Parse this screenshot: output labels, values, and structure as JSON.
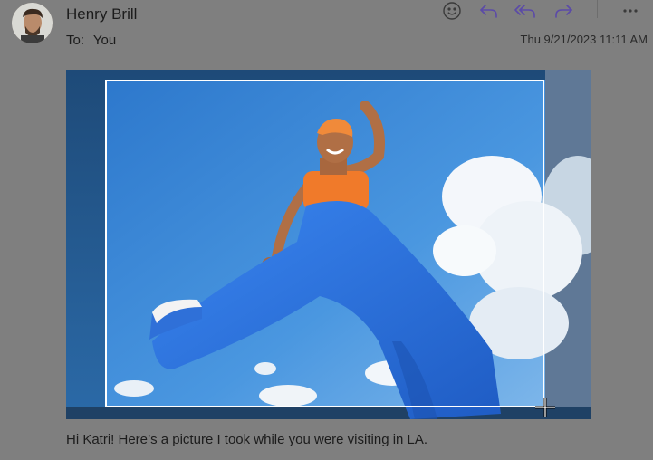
{
  "message": {
    "sender_name": "Henry Brill",
    "to_label": "To:",
    "recipient": "You",
    "timestamp": "Thu 9/21/2023 11:11 AM",
    "body": "Hi Katri! Here’s a picture I took while you were visiting in LA."
  },
  "toolbar": {
    "buttons": [
      {
        "icon": "emoji-icon",
        "action": "react"
      },
      {
        "icon": "reply-icon",
        "action": "reply"
      },
      {
        "icon": "reply-all-icon",
        "action": "reply-all"
      },
      {
        "icon": "forward-icon",
        "action": "forward"
      },
      {
        "icon": "more-icon",
        "action": "more"
      }
    ]
  },
  "attachment": {
    "type": "image",
    "subject": "person in blue pants and orange top posing against sky",
    "selection": "crop"
  },
  "colors": {
    "overlay": "#7f7f7f",
    "accent": "#5b4aa8",
    "sky": "#3d86d4",
    "pants": "#2f70d8",
    "top": "#f07a2a"
  }
}
